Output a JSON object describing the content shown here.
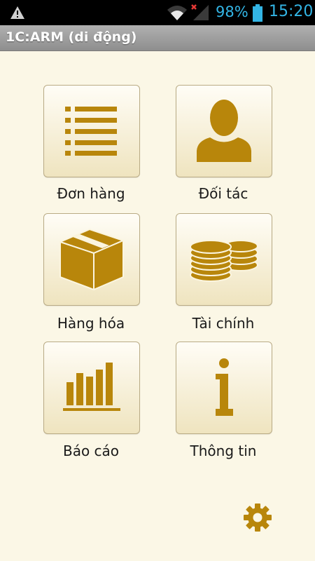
{
  "status_bar": {
    "battery_percent": "98%",
    "time": "15:20",
    "icons": [
      "warning-icon",
      "wifi-icon",
      "signal-icon",
      "battery-icon"
    ]
  },
  "app": {
    "title": "1C:ARM (di động)"
  },
  "menu": {
    "items": [
      {
        "label": "Đơn hàng",
        "icon": "list-icon"
      },
      {
        "label": "Đối tác",
        "icon": "person-icon"
      },
      {
        "label": "Hàng hóa",
        "icon": "box-icon"
      },
      {
        "label": "Tài chính",
        "icon": "coins-icon"
      },
      {
        "label": "Báo cáo",
        "icon": "bar-chart-icon"
      },
      {
        "label": "Thông tin",
        "icon": "info-icon"
      }
    ]
  },
  "settings": {
    "icon": "gear-icon"
  },
  "colors": {
    "accent": "#b8860b",
    "background": "#fbf7e6",
    "status_text": "#33b5e5"
  }
}
